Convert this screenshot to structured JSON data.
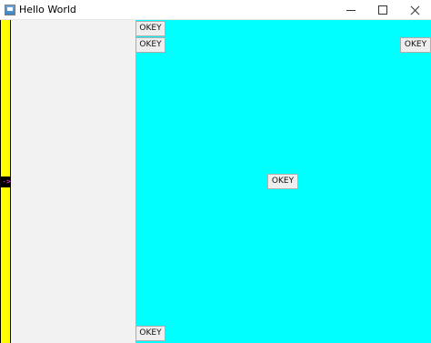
{
  "window": {
    "title": "Hello World",
    "controls": [
      "minimize",
      "maximize",
      "close"
    ]
  },
  "left_bar": {
    "color": "#ffff00",
    "marker_text": "->",
    "marker_color": "#ff3df5"
  },
  "panels": {
    "side_color": "#f2f2f2",
    "main_color": "#00ffff"
  },
  "buttons": [
    {
      "label": "OKEY"
    },
    {
      "label": "OKEY"
    },
    {
      "label": "OKEY"
    },
    {
      "label": "OKEY"
    },
    {
      "label": "OKEY"
    }
  ]
}
